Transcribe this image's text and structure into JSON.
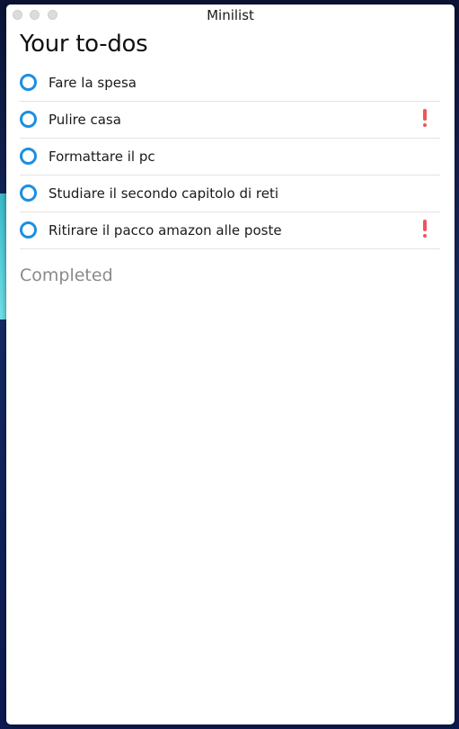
{
  "window": {
    "title": "Minilist"
  },
  "heading": "Your to-dos",
  "todos": [
    {
      "label": "Fare la spesa",
      "important": false
    },
    {
      "label": "Pulire casa",
      "important": true
    },
    {
      "label": "Formattare il pc",
      "important": false
    },
    {
      "label": "Studiare il secondo capitolo di reti",
      "important": false
    },
    {
      "label": "Ritirare il pacco amazon alle poste",
      "important": true
    }
  ],
  "completed_heading": "Completed",
  "colors": {
    "checkbox": "#1a8fe3",
    "important": "#f0545a"
  },
  "icons": {
    "checkbox": "circle-checkbox-icon",
    "important": "exclamation-icon"
  }
}
